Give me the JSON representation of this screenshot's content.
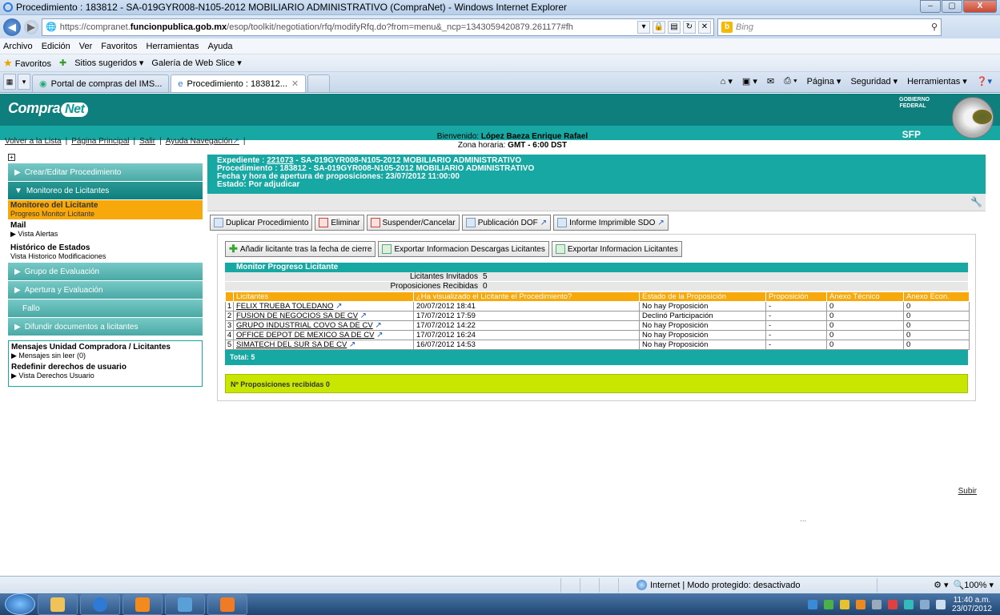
{
  "window": {
    "title": "Procedimiento : 183812 - SA-019GYR008-N105-2012 MOBILIARIO ADMINISTRATIVO (CompraNet) - Windows Internet Explorer",
    "controls": [
      "–",
      "▢",
      "X"
    ]
  },
  "address": {
    "url_prefix": "https://compranet.",
    "url_domain": "funcionpublica.gob.mx",
    "url_rest": "/esop/toolkit/negotiation/rfq/modifyRfq.do?from=menu&_ncp=1343059420879.261177#fh",
    "search_placeholder": "Bing"
  },
  "menubar": [
    "Archivo",
    "Edición",
    "Ver",
    "Favoritos",
    "Herramientas",
    "Ayuda"
  ],
  "favbar": {
    "favoritos": "Favoritos",
    "sitios": "Sitios sugeridos ▾",
    "galeria": "Galería de Web Slice ▾"
  },
  "tabs": [
    {
      "label": "Portal de compras del IMS..."
    },
    {
      "label": "Procedimiento : 183812..."
    }
  ],
  "command_bar": [
    "Página ▾",
    "Seguridad ▾",
    "Herramientas ▾"
  ],
  "banner": {
    "logo_a": "Compra",
    "logo_b": "Net",
    "gobierno": "GOBIERNO FEDERAL",
    "sfp": "SFP"
  },
  "toplinks": [
    "Volver a la Lista",
    "Página Principal",
    "Salir",
    "Ayuda Navegación"
  ],
  "welcome": {
    "line1_prefix": "Bienvenido: ",
    "user": "López Baeza Enrique Rafael",
    "line2_prefix": "Zona horaria: ",
    "zone": "GMT - 6:00 DST"
  },
  "sidebar": {
    "crear": "Crear/Editar Procedimiento",
    "monitoreo": "Monitoreo de Licitantes",
    "sel_title": "Monitoreo del Licitante",
    "sel_sub": "Progreso Monitor Licitante",
    "mail": "Mail",
    "mail_sub": "Vista Alertas",
    "historico": "Histórico de Estados",
    "historico_sub": "Vista Historico Modificaciones",
    "grupo": "Grupo de Evaluación",
    "apertura": "Apertura y Evaluación",
    "fallo": "Fallo",
    "difundir": "Difundir documentos a licitantes",
    "mensajes": "Mensajes Unidad Compradora / Licitantes",
    "mensajes_sub": "Mensajes sin leer (0)",
    "redefinir": "Redefinir derechos de usuario",
    "redefinir_sub": "Vista Derechos Usuario"
  },
  "header": {
    "expediente_label": "Expediente : ",
    "expediente_num": "221073",
    "expediente_rest": " - SA-019GYR008-N105-2012 MOBILIARIO ADMINISTRATIVO",
    "procedimiento": "Procedimiento : 183812 - SA-019GYR008-N105-2012 MOBILIARIO ADMINISTRATIVO",
    "fecha": "Fecha y hora de apertura de proposiciones: 23/07/2012 11:00:00",
    "estado": "Estado: Por adjudicar"
  },
  "actions": [
    "Duplicar Procedimiento",
    "Eliminar",
    "Suspender/Cancelar",
    "Publicación DOF",
    "Informe Imprimible SDO"
  ],
  "inner_actions": [
    "Añadir licitante tras la fecha de cierre",
    "Exportar Informacion Descargas Licitantes",
    "Exportar Informacion Licitantes"
  ],
  "monitor": {
    "title": "Monitor Progreso Licitante",
    "invitados_label": "Licitantes Invitados",
    "invitados": "5",
    "recibidas_label": "Proposiciones Recibidas",
    "recibidas": "0"
  },
  "table": {
    "headers": [
      "Licitantes",
      "¿Ha visualizado el Licitante el Procedimiento?",
      "Estado de la Proposición",
      "Proposición",
      "Anexo Técnico",
      "Anexo Econ."
    ],
    "rows": [
      {
        "n": "1",
        "name": "FELIX TRUEBA TOLEDANO",
        "date": "20/07/2012 18:41",
        "estado": "No hay Proposición",
        "prop": "-",
        "tec": "0",
        "econ": "0"
      },
      {
        "n": "2",
        "name": "FUSION DE NEGOCIOS SA DE CV",
        "date": "17/07/2012 17:59",
        "estado": "Declinó Participación",
        "prop": "-",
        "tec": "0",
        "econ": "0"
      },
      {
        "n": "3",
        "name": "GRUPO INDUSTRIAL COVO SA DE CV",
        "date": "17/07/2012 14:22",
        "estado": "No hay Proposición",
        "prop": "-",
        "tec": "0",
        "econ": "0"
      },
      {
        "n": "4",
        "name": "OFFICE DEPOT DE MEXICO SA DE CV",
        "date": "17/07/2012 16:24",
        "estado": "No hay Proposición",
        "prop": "-",
        "tec": "0",
        "econ": "0"
      },
      {
        "n": "5",
        "name": "SIMATECH DEL SUR SA DE CV",
        "date": "16/07/2012 14:53",
        "estado": "No hay Proposición",
        "prop": "-",
        "tec": "0",
        "econ": "0"
      }
    ],
    "total": "Total: 5"
  },
  "received_bar": "Nº Proposiciones recibidas 0",
  "subir": "Subir",
  "dots": "...",
  "status": {
    "zone": "Internet | Modo protegido: desactivado",
    "zoom": "100%"
  },
  "clock": {
    "time": "11:40 a.m.",
    "date": "23/07/2012"
  }
}
